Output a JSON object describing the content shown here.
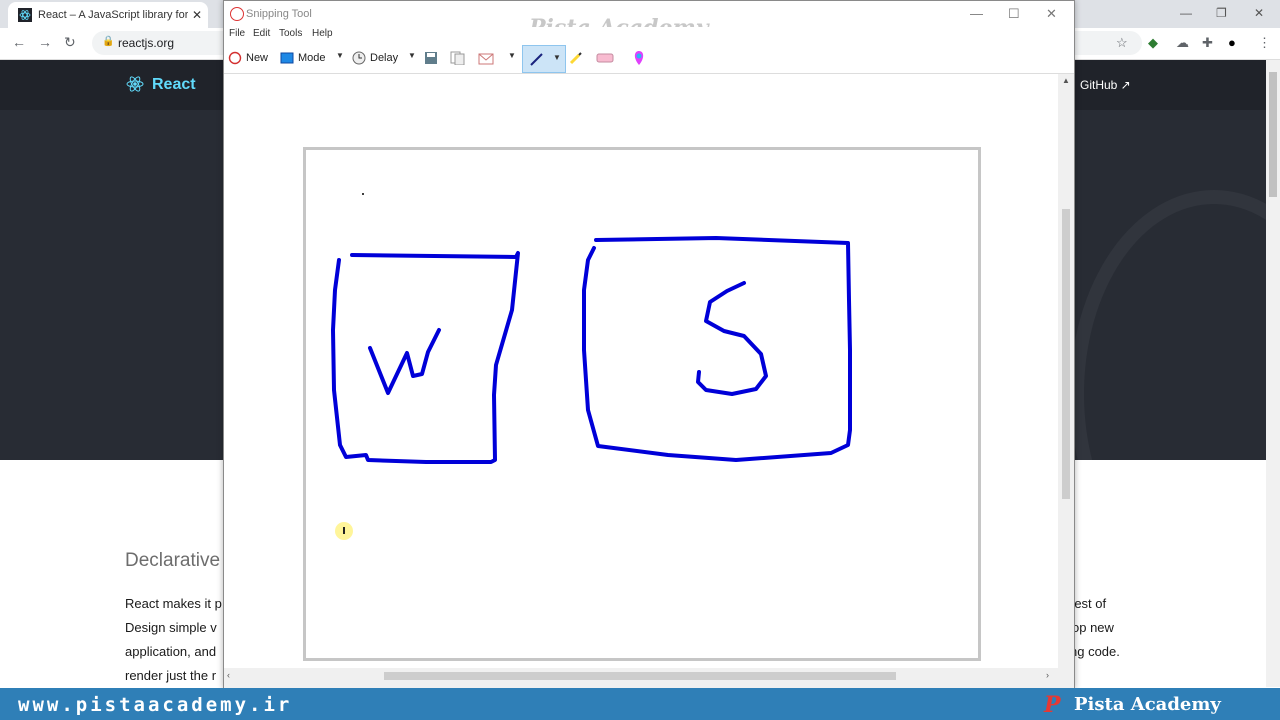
{
  "browser": {
    "tab_title": "React – A JavaScript library for bu",
    "tab_close": "✕",
    "url": "reactjs.org",
    "window_controls": [
      "—",
      "❐",
      "✕"
    ],
    "nav": {
      "back": "←",
      "forward": "→",
      "reload": "↻"
    }
  },
  "page": {
    "brand": "React",
    "github": "GitHub ↗",
    "section_title": "Declarative",
    "paragraph_left": [
      "React makes it p",
      "Design simple v",
      "application, and",
      "render just the r"
    ],
    "paragraph_right": [
      "rest of",
      "op new",
      "ng code."
    ]
  },
  "snipping_tool": {
    "title": "Snipping Tool",
    "watermark": "Pista Academy",
    "window_controls": [
      "—",
      "☐",
      "✕"
    ],
    "menu": [
      "File",
      "Edit",
      "Tools",
      "Help"
    ],
    "toolbar": {
      "new": "New",
      "mode": "Mode",
      "delay": "Delay"
    },
    "drawing": {
      "box1_letter": "W",
      "box2_letter": "S",
      "ink_color": "#0000d8"
    }
  },
  "banner": {
    "site": "www.pistaacademy.ir",
    "brand": "Pista Academy",
    "logo": "P",
    "color": "#2f7fb7"
  }
}
